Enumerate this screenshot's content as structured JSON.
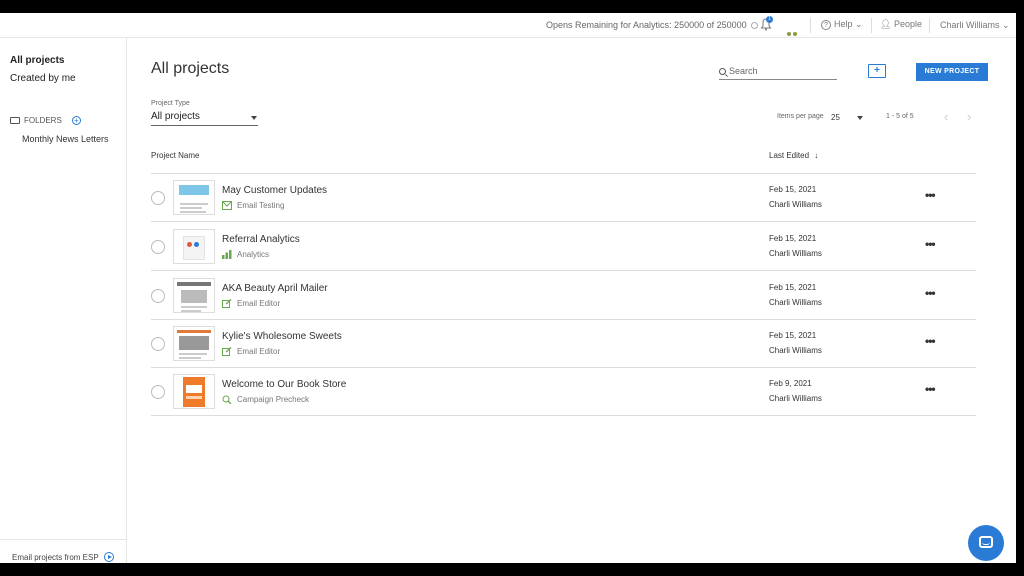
{
  "topbar": {
    "opens_text": "Opens Remaining for Analytics: 250000 of 250000",
    "notification_badge": "1",
    "help_label": "Help",
    "people_label": "People",
    "user_name": "Charli Williams"
  },
  "sidebar": {
    "all_projects": "All projects",
    "created_by_me": "Created by me",
    "folders_label": "FOLDERS",
    "folder_items": [
      "Monthly News Letters"
    ],
    "esp_link": "Email projects from ESP"
  },
  "main": {
    "title": "All projects",
    "search_placeholder": "Search",
    "new_project_label": "NEW PROJECT",
    "project_type_label": "Project Type",
    "project_type_value": "All projects",
    "items_per_page_label": "Items per page",
    "items_per_page_value": "25",
    "range_text": "1 - 5 of 5",
    "columns": {
      "name": "Project Name",
      "last_edited": "Last Edited",
      "sort_arrow": "↓"
    },
    "rows": [
      {
        "name": "May Customer Updates",
        "type": "Email Testing",
        "type_icon": "email-icon",
        "date": "Feb 15, 2021",
        "author": "Charli Williams"
      },
      {
        "name": "Referral Analytics",
        "type": "Analytics",
        "type_icon": "bar-chart-icon",
        "date": "Feb 15, 2021",
        "author": "Charli Williams"
      },
      {
        "name": "AKA Beauty April Mailer",
        "type": "Email Editor",
        "type_icon": "edit-icon",
        "date": "Feb 15, 2021",
        "author": "Charli Williams"
      },
      {
        "name": "Kylie's Wholesome Sweets",
        "type": "Email Editor",
        "type_icon": "edit-icon",
        "date": "Feb 15, 2021",
        "author": "Charli Williams"
      },
      {
        "name": "Welcome to Our Book Store",
        "type": "Campaign Precheck",
        "type_icon": "precheck-icon",
        "date": "Feb 9, 2021",
        "author": "Charli Williams"
      }
    ]
  },
  "colors": {
    "accent": "#2a7bd6",
    "analytics_green": "#6aa84f",
    "border": "#dddddd"
  }
}
